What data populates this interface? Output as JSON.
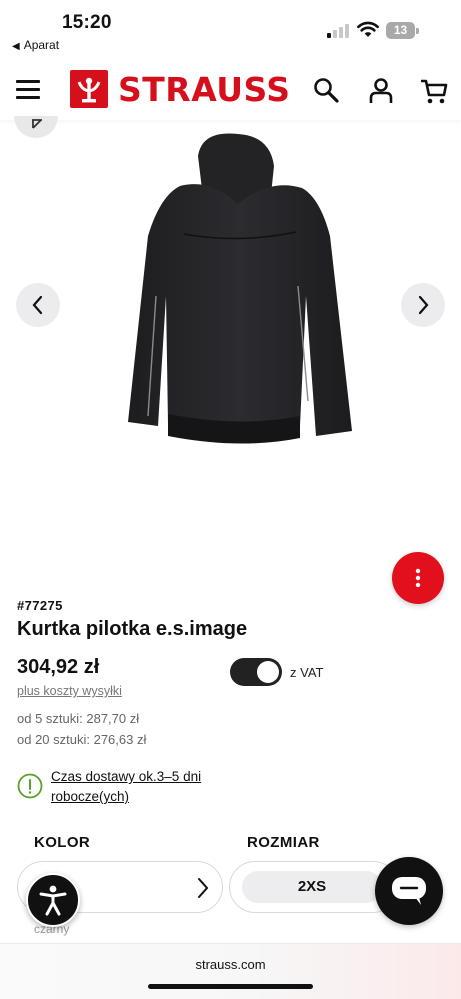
{
  "status_bar": {
    "time": "15:20",
    "back_app": "Aparat",
    "battery": "13"
  },
  "header": {
    "brand": "STRAUSS",
    "icons": [
      "menu-icon",
      "search-icon",
      "account-icon",
      "cart-icon"
    ]
  },
  "product": {
    "sku": "#77275",
    "name": "Kurtka pilotka e.s.image",
    "price": "304,92 zł",
    "shipping_link": "plus koszty wysyłki",
    "vat_toggle_label": "z VAT",
    "vat_toggle_on": true,
    "tier_prices": [
      "od 5 sztuki: 287,70 zł",
      "od 20 sztuki: 276,63 zł"
    ],
    "delivery": "Czas dostawy ok.3–5 dni robocze(ych)"
  },
  "options": {
    "color_label": "KOLOR",
    "size_label": "ROZMIAR",
    "size_value": "2XS",
    "color_caption": "czarny"
  },
  "browser": {
    "url": "strauss.com"
  },
  "colors": {
    "brand_red": "#d5101c",
    "fab_red": "#e2101c",
    "dark": "#111111"
  }
}
